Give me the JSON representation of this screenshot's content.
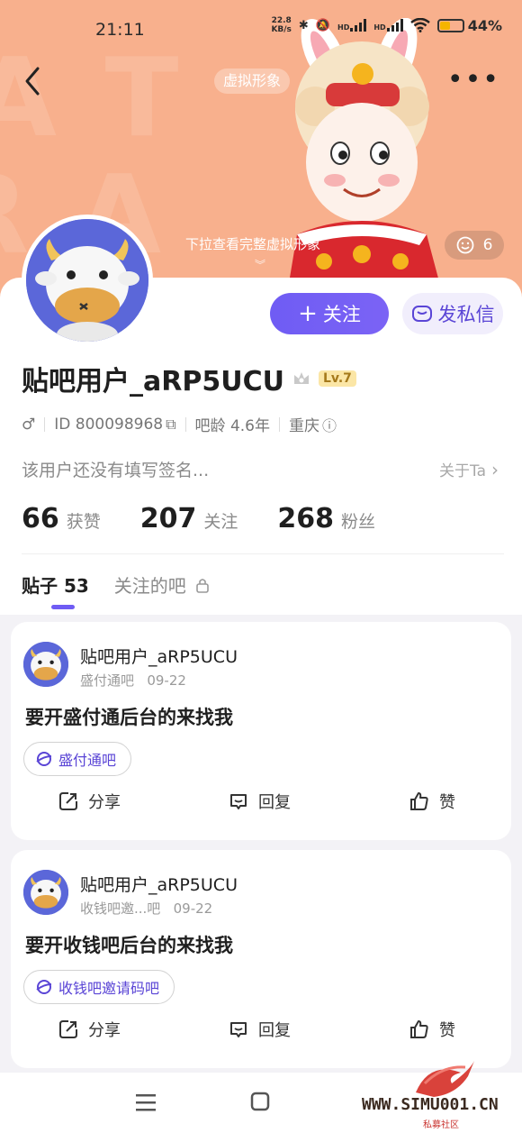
{
  "status_bar": {
    "time": "21:11",
    "net_speed_value": "22.8",
    "net_speed_unit": "KB/s",
    "hd_1": "HD",
    "hd_2": "HD",
    "battery": "44%",
    "battery_level": 0.44
  },
  "header": {
    "avatar_tag": "虚拟形象",
    "pulldown_hint": "下拉查看完整虚拟形象",
    "like_count": "6"
  },
  "profile": {
    "follow_label": "关注",
    "message_label": "发私信",
    "username": "贴吧用户_aRP5UCU",
    "level": "Lv.7",
    "gender_symbol": "♂",
    "id_text": "ID 800098968",
    "age_text": "吧龄 4.6年",
    "location": "重庆",
    "signature": "该用户还没有填写签名...",
    "about": "关于Ta"
  },
  "stats": [
    {
      "num": "66",
      "label": "获赞"
    },
    {
      "num": "207",
      "label": "关注"
    },
    {
      "num": "268",
      "label": "粉丝"
    }
  ],
  "tabs": [
    {
      "label": "贴子 53"
    },
    {
      "label": "关注的吧"
    }
  ],
  "posts": [
    {
      "author": "贴吧用户_aRP5UCU",
      "forum": "盛付通吧",
      "date": "09-22",
      "title": "要开盛付通后台的来找我",
      "tag": "盛付通吧",
      "share": "分享",
      "reply": "回复",
      "like": "赞"
    },
    {
      "author": "贴吧用户_aRP5UCU",
      "forum": "收钱吧邀...吧",
      "date": "09-22",
      "title": "要开收钱吧后台的来找我",
      "tag": "收钱吧邀请码吧",
      "share": "分享",
      "reply": "回复",
      "like": "赞"
    }
  ],
  "watermark": {
    "site": "WWW.SIMU001.CN",
    "sub": "私募社区"
  },
  "colors": {
    "banner": "#f8b08d",
    "accent": "#6f5cf4"
  }
}
